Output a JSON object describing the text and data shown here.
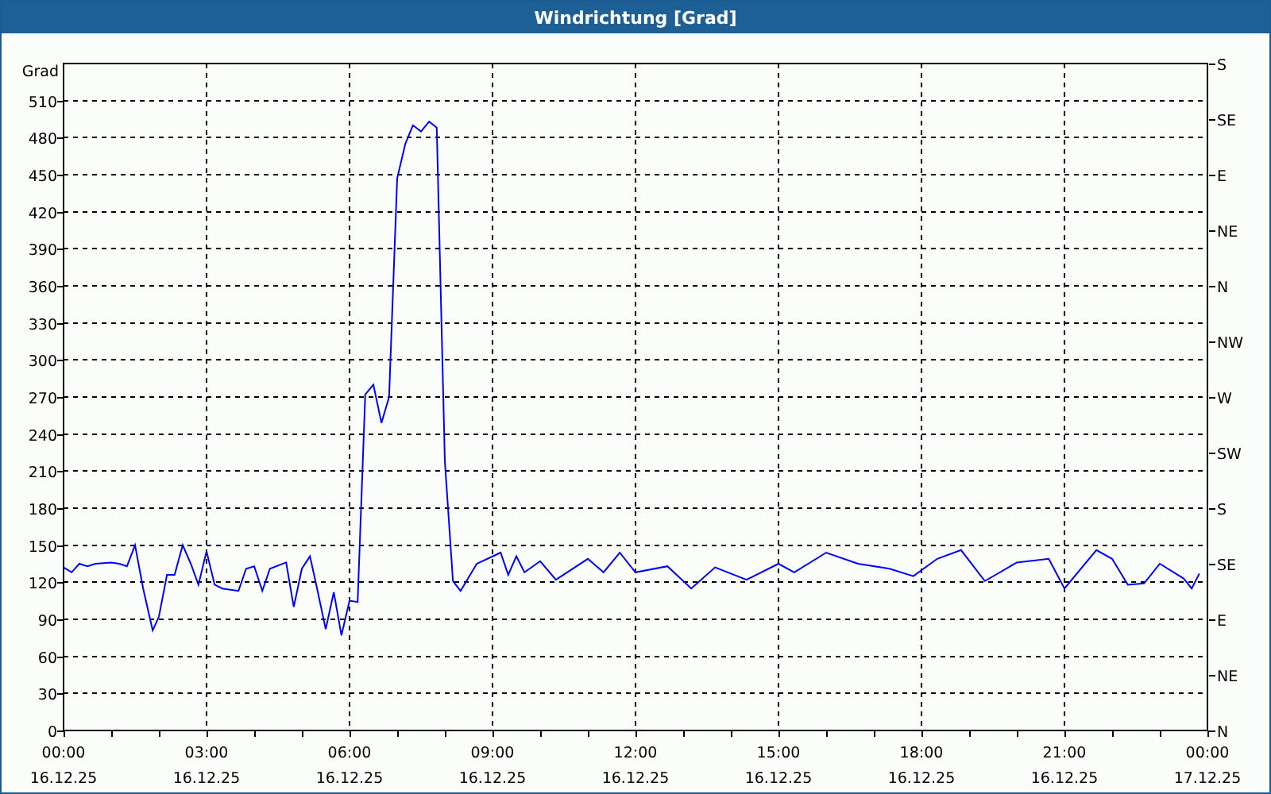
{
  "window": {
    "title": "Windrichtung [Grad]"
  },
  "chart": {
    "chart_data": {
      "type": "line",
      "grid": true,
      "ylabel": "Grad",
      "xlim": [
        0,
        24
      ],
      "ylim": [
        0,
        540
      ],
      "yticks": [
        0,
        30,
        60,
        90,
        120,
        150,
        180,
        210,
        240,
        270,
        300,
        330,
        360,
        390,
        420,
        450,
        480,
        510
      ],
      "xticks": [
        {
          "value": 0,
          "label": "00:00"
        },
        {
          "value": 3,
          "label": "03:00"
        },
        {
          "value": 6,
          "label": "06:00"
        },
        {
          "value": 9,
          "label": "09:00"
        },
        {
          "value": 12,
          "label": "12:00"
        },
        {
          "value": 15,
          "label": "15:00"
        },
        {
          "value": 18,
          "label": "18:00"
        },
        {
          "value": 21,
          "label": "21:00"
        },
        {
          "value": 24,
          "label": "00:00"
        }
      ],
      "series": [
        {
          "color": "#0000ff",
          "x": [
            0,
            0.17,
            0.33,
            0.5,
            0.67,
            1,
            1.17,
            1.33,
            1.5,
            1.67,
            1.87,
            2,
            2.17,
            2.33,
            2.5,
            2.67,
            2.83,
            3,
            3.17,
            3.33,
            3.67,
            3.83,
            4,
            4.17,
            4.33,
            4.67,
            4.83,
            5,
            5.17,
            5.33,
            5.5,
            5.67,
            5.83,
            6,
            6.17,
            6.33,
            6.5,
            6.67,
            6.83,
            7,
            7.17,
            7.33,
            7.5,
            7.67,
            7.83,
            8,
            8.17,
            8.33,
            8.67,
            9.17,
            9.33,
            9.5,
            9.67,
            10,
            10.33,
            11,
            11.33,
            11.67,
            12,
            12.67,
            13.17,
            13.67,
            14.33,
            15,
            15.33,
            16,
            16.67,
            17.33,
            17.83,
            18.33,
            18.83,
            19.33,
            20,
            20.67,
            21,
            21.67,
            22,
            22.33,
            22.67,
            23,
            23.5,
            23.67,
            23.83
          ],
          "values": [
            132,
            128,
            135,
            133,
            135,
            136,
            135,
            133,
            150,
            115,
            81,
            92,
            126,
            126,
            150,
            135,
            118,
            145,
            118,
            115,
            113,
            131,
            133,
            113,
            131,
            136,
            100,
            131,
            141,
            113,
            82,
            112,
            77,
            105,
            104,
            272,
            280,
            249,
            270,
            447,
            475,
            490,
            485,
            493,
            488,
            218,
            121,
            113,
            135,
            144,
            126,
            141,
            128,
            137,
            122,
            139,
            128,
            144,
            128,
            133,
            115,
            132,
            122,
            135,
            128,
            144,
            135,
            131,
            125,
            139,
            146,
            121,
            136,
            139,
            115,
            146,
            139,
            118,
            119,
            135,
            123,
            115,
            127
          ]
        }
      ]
    },
    "xtick_dates": [
      "16.12.25",
      "16.12.25",
      "16.12.25",
      "16.12.25",
      "16.12.25",
      "16.12.25",
      "16.12.25",
      "16.12.25",
      "17.12.25"
    ],
    "compass_labels": [
      "S",
      "SE",
      "E",
      "NE",
      "N",
      "NW",
      "W",
      "SW",
      "S",
      "SE",
      "E",
      "NE",
      "N"
    ]
  }
}
